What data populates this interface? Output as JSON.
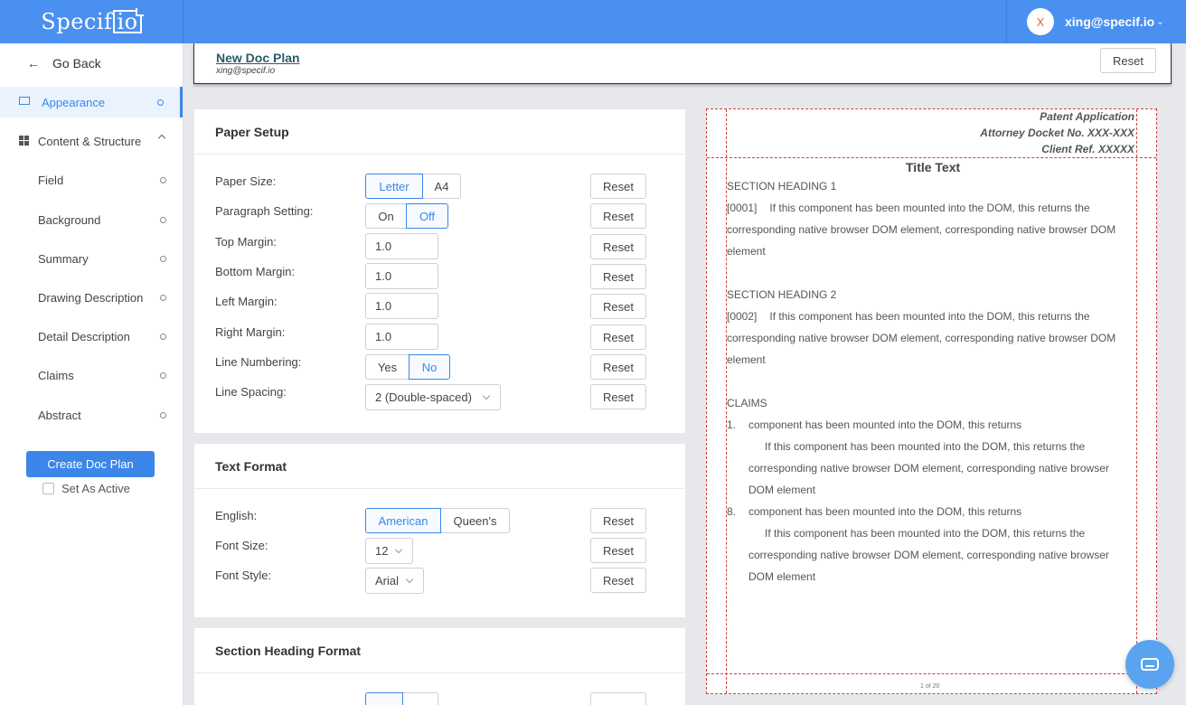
{
  "app": {
    "logo": "Specif",
    "logo_io": "io",
    "accent": "#4a90f0"
  },
  "user": {
    "initial": "X",
    "email": "xing@specif.io"
  },
  "sidebar": {
    "go_back": "Go Back",
    "appearance": "Appearance",
    "content_structure": "Content & Structure",
    "items": [
      {
        "label": "Field"
      },
      {
        "label": "Background"
      },
      {
        "label": "Summary"
      },
      {
        "label": "Drawing Description"
      },
      {
        "label": "Detail Description"
      },
      {
        "label": "Claims"
      },
      {
        "label": "Abstract"
      }
    ],
    "create_label": "Create Doc Plan",
    "set_active_label": "Set As Active"
  },
  "doc": {
    "title": "New Doc Plan",
    "subtitle": "xing@specif.io",
    "reset_label": "Reset"
  },
  "paper_setup": {
    "title": "Paper Setup",
    "paper_size": {
      "label": "Paper Size:",
      "options": [
        "Letter",
        "A4"
      ],
      "selected": "Letter"
    },
    "paragraph_setting": {
      "label": "Paragraph Setting:",
      "options": [
        "On",
        "Off"
      ],
      "selected": "Off"
    },
    "top_margin": {
      "label": "Top Margin:",
      "value": "1.0"
    },
    "bottom_margin": {
      "label": "Bottom Margin:",
      "value": "1.0"
    },
    "left_margin": {
      "label": "Left Margin:",
      "value": "1.0"
    },
    "right_margin": {
      "label": "Right Margin:",
      "value": "1.0"
    },
    "line_numbering": {
      "label": "Line Numbering:",
      "options": [
        "Yes",
        "No"
      ],
      "selected": "No"
    },
    "line_spacing": {
      "label": "Line Spacing:",
      "value": "2 (Double-spaced)"
    }
  },
  "text_format": {
    "title": "Text Format",
    "english": {
      "label": "English:",
      "options": [
        "American",
        "Queen's"
      ],
      "selected": "American"
    },
    "font_size": {
      "label": "Font Size:",
      "value": "12"
    },
    "font_style": {
      "label": "Font Style:",
      "value": "Arial"
    }
  },
  "section_heading_format": {
    "title": "Section Heading Format"
  },
  "reset_label": "Reset",
  "preview": {
    "header_line1": "Patent Application",
    "header_line2": "Attorney Docket No. XXX-XXX",
    "header_line3": "Client Ref. XXXXX",
    "title": "Title Text",
    "section1": "SECTION HEADING 1",
    "para1_num": "[0001]",
    "para1_text": "If this component has been mounted into the DOM, this returns the corresponding native browser DOM element, corresponding native browser DOM element",
    "section2": "SECTION HEADING 2",
    "para2_num": "[0002]",
    "para2_text": "If this component has been mounted into the DOM, this returns the corresponding native browser DOM element, corresponding native browser DOM element",
    "claims_heading": "CLAIMS",
    "claims": [
      {
        "num": "1.",
        "title": "component has been mounted into the DOM, this returns",
        "body": "If this component has been mounted into the DOM, this returns the corresponding native browser DOM element, corresponding native browser DOM element"
      },
      {
        "num": "8.",
        "title": "component has been mounted into the DOM, this returns",
        "body": "If this component has been mounted into the DOM, this returns the corresponding native browser DOM element, corresponding native browser DOM element"
      }
    ],
    "page_indicator": "1 of 20"
  }
}
